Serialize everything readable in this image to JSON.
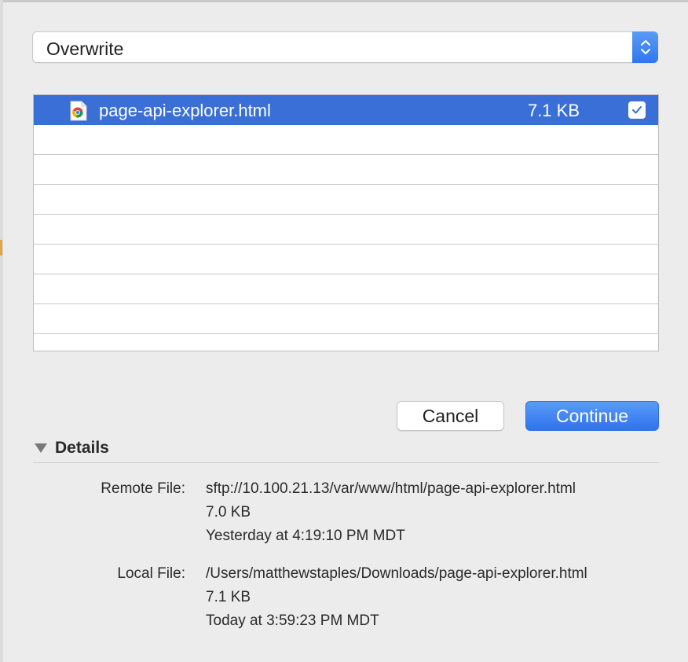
{
  "dropdown": {
    "selected": "Overwrite"
  },
  "files": [
    {
      "name": "page-api-explorer.html",
      "size": "7.1 KB",
      "checked": true
    }
  ],
  "buttons": {
    "cancel": "Cancel",
    "continue": "Continue"
  },
  "details": {
    "title": "Details",
    "remote": {
      "label": "Remote File:",
      "path": "sftp://10.100.21.13/var/www/html/page-api-explorer.html",
      "size": "7.0 KB",
      "modified": "Yesterday at 4:19:10 PM MDT"
    },
    "local": {
      "label": "Local File:",
      "path": "/Users/matthewstaples/Downloads/page-api-explorer.html",
      "size": "7.1 KB",
      "modified": "Today at 3:59:23 PM MDT"
    }
  },
  "colors": {
    "accent": "#3a6fd8",
    "button_blue": "#3b7ff1",
    "background": "#ececec"
  },
  "icons": {
    "file": "chrome-html-document-icon",
    "stepper": "up-down-chevron-icon",
    "check": "checkmark-icon",
    "disclosure": "disclosure-triangle-down-icon"
  }
}
